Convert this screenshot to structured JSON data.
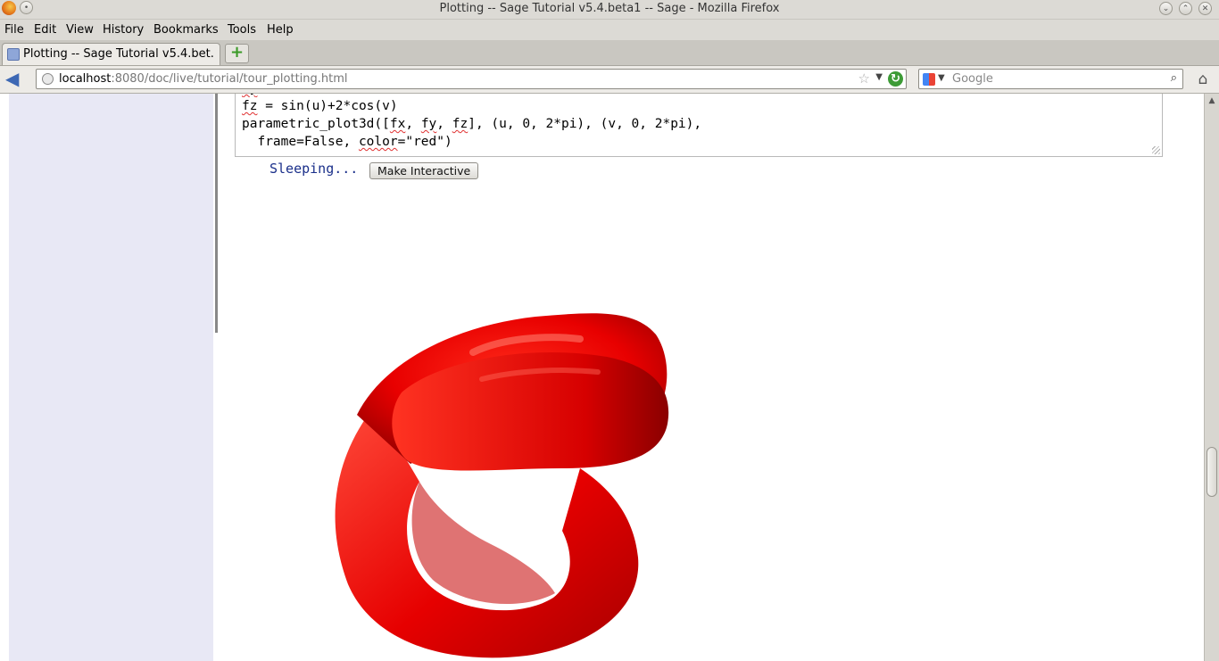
{
  "window": {
    "title": "Plotting -- Sage Tutorial v5.4.beta1 -- Sage - Mozilla Firefox"
  },
  "menu": {
    "items": [
      "File",
      "Edit",
      "View",
      "History",
      "Bookmarks",
      "Tools",
      "Help"
    ]
  },
  "tab": {
    "label": "Plotting -- Sage Tutorial v5.4.bet..."
  },
  "urlbar": {
    "host": "localhost",
    "rest": ":8080/doc/live/tutorial/tour_plotting.html"
  },
  "search": {
    "placeholder": "Google"
  },
  "code": {
    "line1": "fz = sin(u)+2*cos(v)",
    "line2_a": "parametric_plot3d([",
    "line2_fx": "fx",
    "line2_b": ", ",
    "line2_fy": "fy",
    "line2_c": ", ",
    "line2_fz": "fz",
    "line2_d": "], (u, 0, 2*pi), (v, 0, 2*pi),",
    "line3_a": "  frame=False, ",
    "line3_color": "color",
    "line3_b": "=\"red\")"
  },
  "cell": {
    "status": "Sleeping...",
    "interactive_button": "Make Interactive"
  },
  "plot": {
    "color": "#ff0000"
  }
}
